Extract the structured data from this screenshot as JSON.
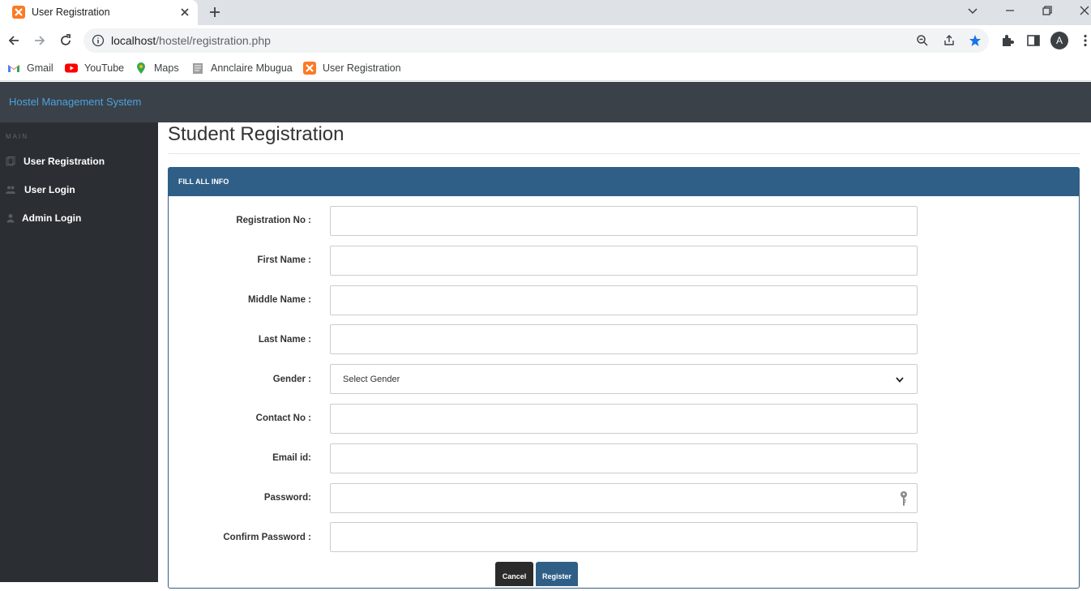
{
  "browser": {
    "tab_title": "User Registration",
    "url_host": "localhost",
    "url_path": "/hostel/registration.php",
    "avatar_letter": "A",
    "bookmarks": [
      {
        "label": "Gmail",
        "icon": "gmail-icon"
      },
      {
        "label": "YouTube",
        "icon": "youtube-icon"
      },
      {
        "label": "Maps",
        "icon": "maps-icon"
      },
      {
        "label": "Annclaire Mbugua",
        "icon": "page-icon"
      },
      {
        "label": "User Registration",
        "icon": "xampp-icon"
      }
    ]
  },
  "app": {
    "brand": "Hostel Management System",
    "sidebar": {
      "heading": "MAIN",
      "items": [
        {
          "label": "User Registration",
          "icon": "files-icon"
        },
        {
          "label": "User Login",
          "icon": "users-icon"
        },
        {
          "label": "Admin Login",
          "icon": "user-icon"
        }
      ]
    },
    "page_title": "Student Registration",
    "panel_title": "FILL ALL INFO",
    "form": {
      "registration_no": "Registration No :",
      "first_name": "First Name :",
      "middle_name": "Middle Name :",
      "last_name": "Last Name :",
      "gender": "Gender :",
      "gender_selected": "Select Gender",
      "contact_no": "Contact No :",
      "email": "Email id:",
      "password": "Password:",
      "confirm_password": "Confirm Password :"
    },
    "buttons": {
      "cancel": "Cancel",
      "register": "Register"
    }
  },
  "colors": {
    "header": "#3b4149",
    "sidebar": "#2b2f33",
    "panel": "#2f5f87",
    "brand": "#4aa3df"
  }
}
